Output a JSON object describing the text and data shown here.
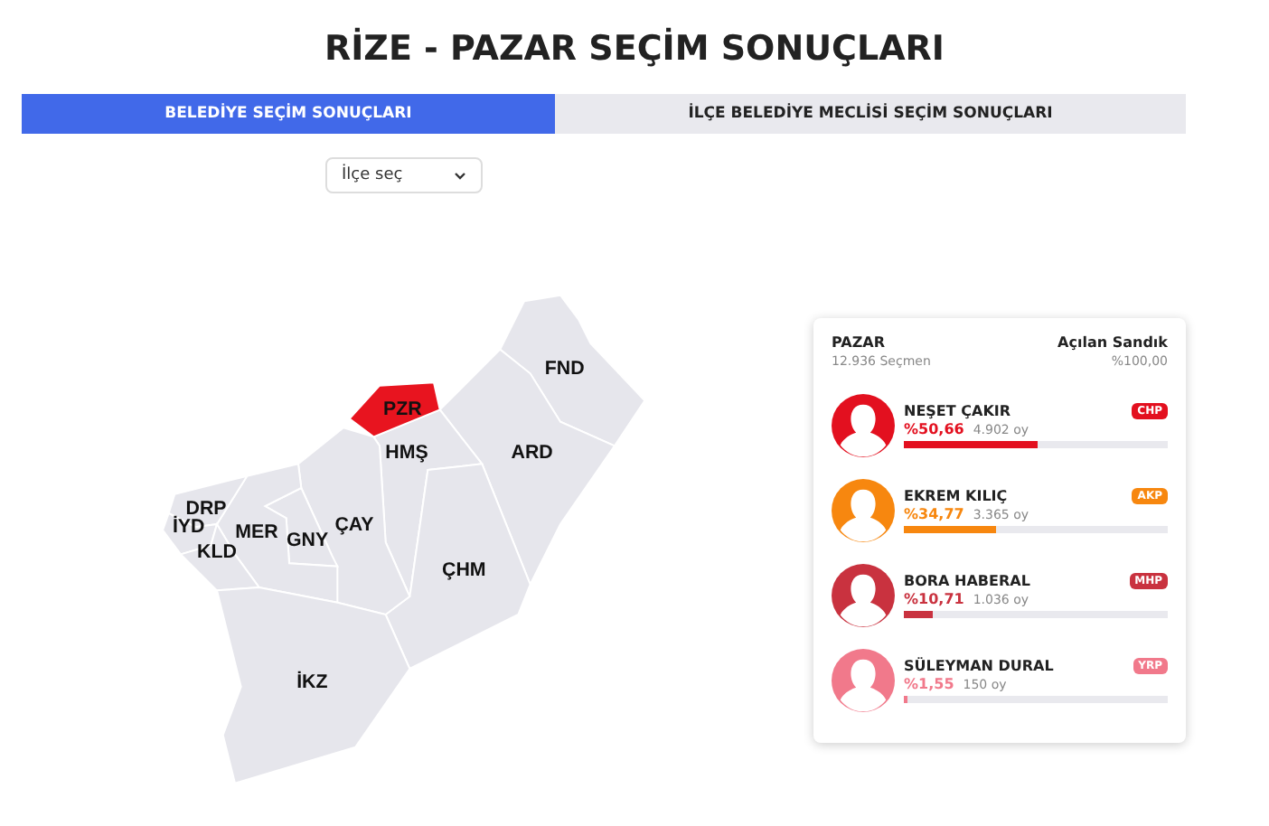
{
  "title": "RİZE - PAZAR SEÇİM SONUÇLARI",
  "tabs": [
    {
      "label": "BELEDİYE SEÇİM SONUÇLARI",
      "selected": true
    },
    {
      "label": "İLÇE BELEDİYE MECLİSİ SEÇİM SONUÇLARI",
      "selected": false
    }
  ],
  "district_select": {
    "value": "İlçe seç"
  },
  "map": {
    "districts": [
      {
        "label": "FND",
        "selected": false
      },
      {
        "label": "ARD",
        "selected": false
      },
      {
        "label": "HMŞ",
        "selected": false
      },
      {
        "label": "ÇHM",
        "selected": false
      },
      {
        "label": "ÇAY",
        "selected": false
      },
      {
        "label": "GNY",
        "selected": false
      },
      {
        "label": "MER",
        "selected": false
      },
      {
        "label": "DRP",
        "selected": false
      },
      {
        "label": "İYD",
        "selected": false
      },
      {
        "label": "KLD",
        "selected": false
      },
      {
        "label": "İKZ",
        "selected": false
      },
      {
        "label": "PZR",
        "selected": true
      }
    ]
  },
  "results": {
    "district": "PAZAR",
    "voters": "12.936 Seçmen",
    "opened_label": "Açılan Sandık",
    "opened_value": "%100,00",
    "candidates": [
      {
        "name": "NEŞET ÇAKIR",
        "party": "CHP",
        "percent": "%50,66",
        "votes": "4.902 oy",
        "level": 0.5066,
        "color": "#e3101f"
      },
      {
        "name": "EKREM KILIÇ",
        "party": "AKP",
        "percent": "%34,77",
        "votes": "3.365 oy",
        "level": 0.3477,
        "color": "#f7870f"
      },
      {
        "name": "BORA HABERAL",
        "party": "MHP",
        "percent": "%10,71",
        "votes": "1.036 oy",
        "level": 0.1071,
        "color": "#c9323f"
      },
      {
        "name": "SÜLEYMAN DURAL",
        "party": "YRP",
        "percent": "%1,55",
        "votes": "150 oy",
        "level": 0.0155,
        "color": "#f1798b"
      }
    ]
  }
}
